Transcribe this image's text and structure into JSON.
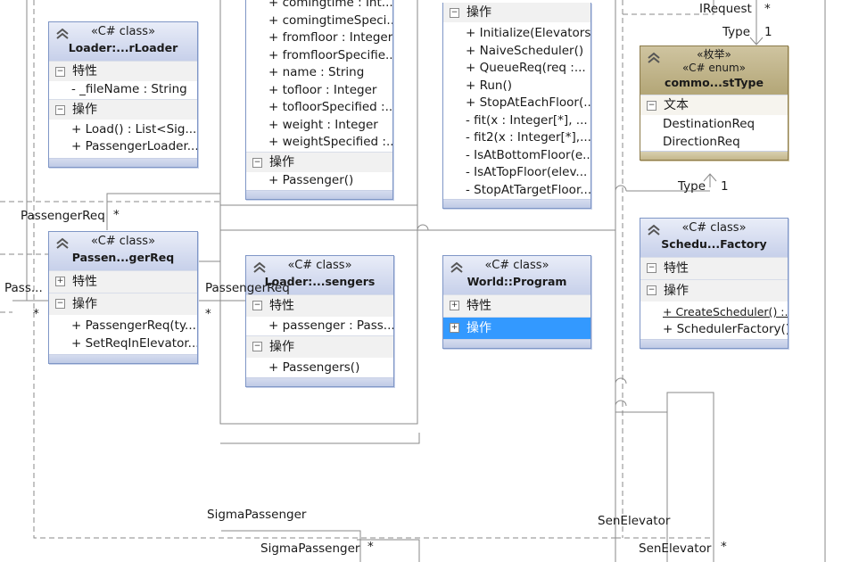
{
  "boxes": {
    "loader": {
      "stereotype": "«C# class»",
      "name": "Loader:...rLoader",
      "sections": [
        {
          "label": "特性",
          "items": [
            "- _fileName : String"
          ]
        },
        {
          "label": "操作",
          "items": [
            "+ Load() : List<Sig...",
            "+  PassengerLoader..."
          ]
        }
      ]
    },
    "passenger": {
      "items_top": [
        "+ comingtime : Int...",
        "+ comingtimeSpeci...",
        "+ fromfloor : Integer",
        "+ fromfloorSpecifie...",
        "+ name : String",
        "+ tofloor : Integer",
        "+ tofloorSpecified :...",
        "+ weight : Integer",
        "+ weightSpecified :..."
      ],
      "ops_label": "操作",
      "ops": [
        "+ Passenger()"
      ]
    },
    "scheduler": {
      "ops_label": "操作",
      "ops": [
        "+ Initialize(Elevators...",
        "+ NaiveScheduler()",
        "+ QueueReq(req  :...",
        "+ Run()",
        "+ StopAtEachFloor(...",
        "- fit(x : Integer[*], ...",
        "- fit2(x : Integer[*],...",
        "- IsAtBottomFloor(e...",
        "- IsAtTopFloor(elev...",
        "- StopAtTargetFloor..."
      ]
    },
    "enum": {
      "stereo_cn": "«枚举»",
      "stereotype": "«C# enum»",
      "name": "commo...stType",
      "section": "文本",
      "items": [
        "DestinationReq",
        "DirectionReq"
      ]
    },
    "passengerReq": {
      "stereotype": "«C# class»",
      "name": "Passen...gerReq",
      "sections": [
        {
          "label": "特性",
          "items": [],
          "collapsed": true
        },
        {
          "label": "操作",
          "items": [
            "+ PassengerReq(ty...",
            "+ SetReqInElevator..."
          ]
        }
      ]
    },
    "passengers": {
      "stereotype": "«C# class»",
      "name": "Loader:...sengers",
      "sections": [
        {
          "label": "特性",
          "items": [
            "+ passenger  : Pass..."
          ]
        },
        {
          "label": "操作",
          "items": [
            "+ Passengers()"
          ]
        }
      ]
    },
    "program": {
      "stereotype": "«C# class»",
      "name": "World::Program",
      "sections": [
        {
          "label": "特性",
          "items": [],
          "collapsed": true
        },
        {
          "label": "操作",
          "items": [],
          "collapsed": true,
          "selected": true
        }
      ]
    },
    "factory": {
      "stereotype": "«C# class»",
      "name": "Schedu...Factory",
      "sections": [
        {
          "label": "特性",
          "items": []
        },
        {
          "label": "操作",
          "items": [
            "+ CreateScheduler() :...",
            "+ SchedulerFactory()"
          ]
        }
      ]
    }
  },
  "labels": {
    "irequest": "IRequest",
    "star_top": "*",
    "type_top": "Type",
    "one_top": "1",
    "type_mid": "Type",
    "one_mid": "1",
    "passengerreq_lbl": "PassengerReq",
    "star_preq": "*",
    "pass_left": "Pass...",
    "star_left": "*",
    "passengerreq_lbl2": "PassengerReq",
    "star_preq2": "*",
    "sigma1": "SigmaPassenger",
    "sigma2": "SigmaPassenger",
    "star_sigma": "*",
    "senelev1": "SenElevator",
    "senelev2": "SenElevator",
    "star_sen": "*"
  },
  "colors": {
    "class_header": "#c7d0ea",
    "enum_header": "#b3a677",
    "selected": "#3399ff",
    "line": "#8a8a8a"
  }
}
